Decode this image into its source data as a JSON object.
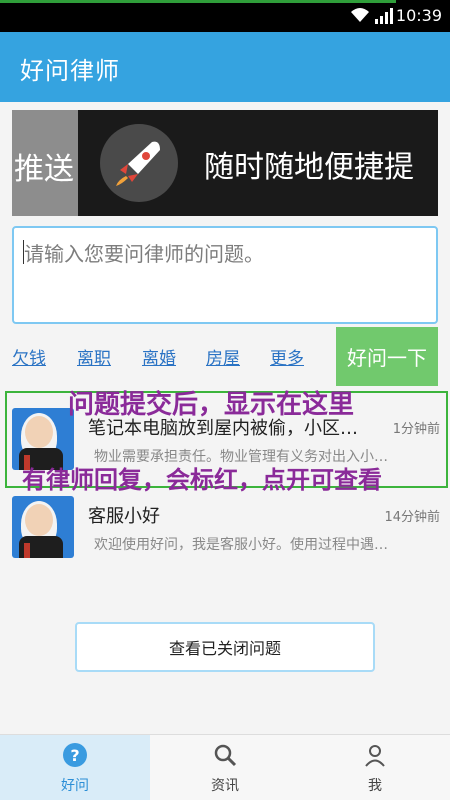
{
  "status": {
    "time": "10:39"
  },
  "app": {
    "title": "好问律师"
  },
  "banner": {
    "left_text": "推送",
    "text": "随时随地便捷提"
  },
  "question": {
    "placeholder": "请输入您要问律师的问题。"
  },
  "categories": [
    "欠钱",
    "离职",
    "离婚",
    "房屋",
    "更多"
  ],
  "ask_button": "好问一下",
  "annotations": {
    "top": "问题提交后，显示在这里",
    "bottom": "有律师回复，会标红，点开可查看"
  },
  "conversations": [
    {
      "title": "笔记本电脑放到屋内被偷，小区…",
      "time": "1分钟前",
      "preview": "物业需要承担责任。物业管理有义务对出入小…"
    },
    {
      "title": "客服小好",
      "time": "14分钟前",
      "preview": "欢迎使用好问，我是客服小好。使用过程中遇…"
    }
  ],
  "closed_button": "查看已关闭问题",
  "tabs": [
    {
      "label": "好问",
      "icon": "question-icon",
      "active": true
    },
    {
      "label": "资讯",
      "icon": "search-icon",
      "active": false
    },
    {
      "label": "我",
      "icon": "person-icon",
      "active": false
    }
  ],
  "colors": {
    "accent": "#35a3e0",
    "ask_button": "#71c96d",
    "annotation": "#8a2a99",
    "highlight": "#3cb43c"
  }
}
